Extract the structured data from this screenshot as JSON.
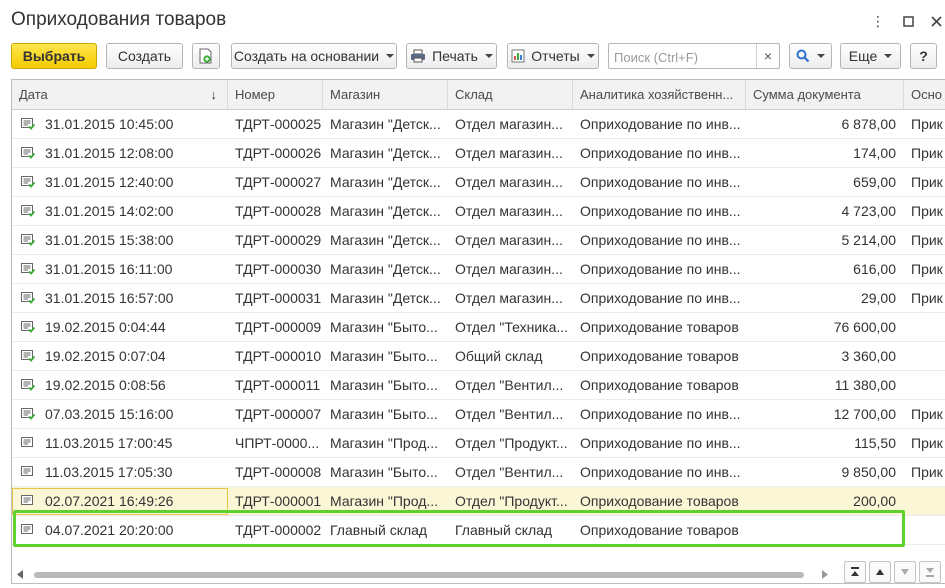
{
  "window": {
    "title": "Оприходования товаров",
    "menu_icon": "kebab-menu-icon",
    "maximize_icon": "maximize-icon",
    "close_icon": "close-icon"
  },
  "toolbar": {
    "select_label": "Выбрать",
    "create_label": "Создать",
    "copy_icon": "copy-document-icon",
    "create_based_label": "Создать на основании",
    "print_label": "Печать",
    "reports_label": "Отчеты",
    "search_placeholder": "Поиск (Ctrl+F)",
    "clear_glyph": "×",
    "more_label": "Еще",
    "help_label": "?"
  },
  "colors": {
    "accent_yellow": "#f5cc00",
    "highlight_green": "#5ed12f",
    "posted_icon_green": "#3aa935"
  },
  "table": {
    "sort_glyph": "↓",
    "columns": [
      "Дата",
      "Номер",
      "Магазин",
      "Склад",
      "Аналитика хозяйственн...",
      "Сумма документа",
      "Осно"
    ],
    "rows": [
      {
        "date": "31.01.2015 10:45:00",
        "number": "ТДРТ-000025",
        "store": "Магазин \"Детск...",
        "warehouse": "Отдел магазин...",
        "analytics": "Оприходование по инв...",
        "sum": "6 878,00",
        "basis": "Прик",
        "posted": true
      },
      {
        "date": "31.01.2015 12:08:00",
        "number": "ТДРТ-000026",
        "store": "Магазин \"Детск...",
        "warehouse": "Отдел магазин...",
        "analytics": "Оприходование по инв...",
        "sum": "174,00",
        "basis": "Прик",
        "posted": true
      },
      {
        "date": "31.01.2015 12:40:00",
        "number": "ТДРТ-000027",
        "store": "Магазин \"Детск...",
        "warehouse": "Отдел магазин...",
        "analytics": "Оприходование по инв...",
        "sum": "659,00",
        "basis": "Прик",
        "posted": true
      },
      {
        "date": "31.01.2015 14:02:00",
        "number": "ТДРТ-000028",
        "store": "Магазин \"Детск...",
        "warehouse": "Отдел магазин...",
        "analytics": "Оприходование по инв...",
        "sum": "4 723,00",
        "basis": "Прик",
        "posted": true
      },
      {
        "date": "31.01.2015 15:38:00",
        "number": "ТДРТ-000029",
        "store": "Магазин \"Детск...",
        "warehouse": "Отдел магазин...",
        "analytics": "Оприходование по инв...",
        "sum": "5 214,00",
        "basis": "Прик",
        "posted": true
      },
      {
        "date": "31.01.2015 16:11:00",
        "number": "ТДРТ-000030",
        "store": "Магазин \"Детск...",
        "warehouse": "Отдел магазин...",
        "analytics": "Оприходование по инв...",
        "sum": "616,00",
        "basis": "Прик",
        "posted": true
      },
      {
        "date": "31.01.2015 16:57:00",
        "number": "ТДРТ-000031",
        "store": "Магазин \"Детск...",
        "warehouse": "Отдел магазин...",
        "analytics": "Оприходование по инв...",
        "sum": "29,00",
        "basis": "Прик",
        "posted": true
      },
      {
        "date": "19.02.2015 0:04:44",
        "number": "ТДРТ-000009",
        "store": "Магазин \"Быто...",
        "warehouse": "Отдел \"Техника...",
        "analytics": "Оприходование товаров",
        "sum": "76 600,00",
        "basis": "",
        "posted": true
      },
      {
        "date": "19.02.2015 0:07:04",
        "number": "ТДРТ-000010",
        "store": "Магазин \"Быто...",
        "warehouse": "Общий склад",
        "analytics": "Оприходование товаров",
        "sum": "3 360,00",
        "basis": "",
        "posted": true
      },
      {
        "date": "19.02.2015 0:08:56",
        "number": "ТДРТ-000011",
        "store": "Магазин \"Быто...",
        "warehouse": "Отдел  \"Вентил...",
        "analytics": "Оприходование товаров",
        "sum": "11 380,00",
        "basis": "",
        "posted": true
      },
      {
        "date": "07.03.2015 15:16:00",
        "number": "ТДРТ-000007",
        "store": "Магазин \"Быто...",
        "warehouse": "Отдел  \"Вентил...",
        "analytics": "Оприходование по инв...",
        "sum": "12 700,00",
        "basis": "Прик",
        "posted": true
      },
      {
        "date": "11.03.2015 17:00:45",
        "number": "ЧПРТ-0000...",
        "store": "Магазин \"Прод...",
        "warehouse": "Отдел \"Продукт...",
        "analytics": "Оприходование по инв...",
        "sum": "115,50",
        "basis": "Прик",
        "posted": false
      },
      {
        "date": "11.03.2015 17:05:30",
        "number": "ТДРТ-000008",
        "store": "Магазин \"Быто...",
        "warehouse": "Отдел  \"Вентил...",
        "analytics": "Оприходование по инв...",
        "sum": "9 850,00",
        "basis": "Прик",
        "posted": false
      },
      {
        "date": "02.07.2021 16:49:26",
        "number": "ТДРТ-000001",
        "store": "Магазин \"Прод...",
        "warehouse": "Отдел \"Продукт...",
        "analytics": "Оприходование товаров",
        "sum": "200,00",
        "basis": "",
        "posted": false
      },
      {
        "date": "04.07.2021 20:20:00",
        "number": "ТДРТ-000002",
        "store": "Главный склад",
        "warehouse": "Главный склад",
        "analytics": "Оприходование товаров",
        "sum": "",
        "basis": "",
        "posted": false
      }
    ]
  },
  "footer": {
    "nav_icons": [
      "scroll-to-top-icon",
      "scroll-up-icon",
      "scroll-down-icon",
      "scroll-to-bottom-icon"
    ]
  }
}
